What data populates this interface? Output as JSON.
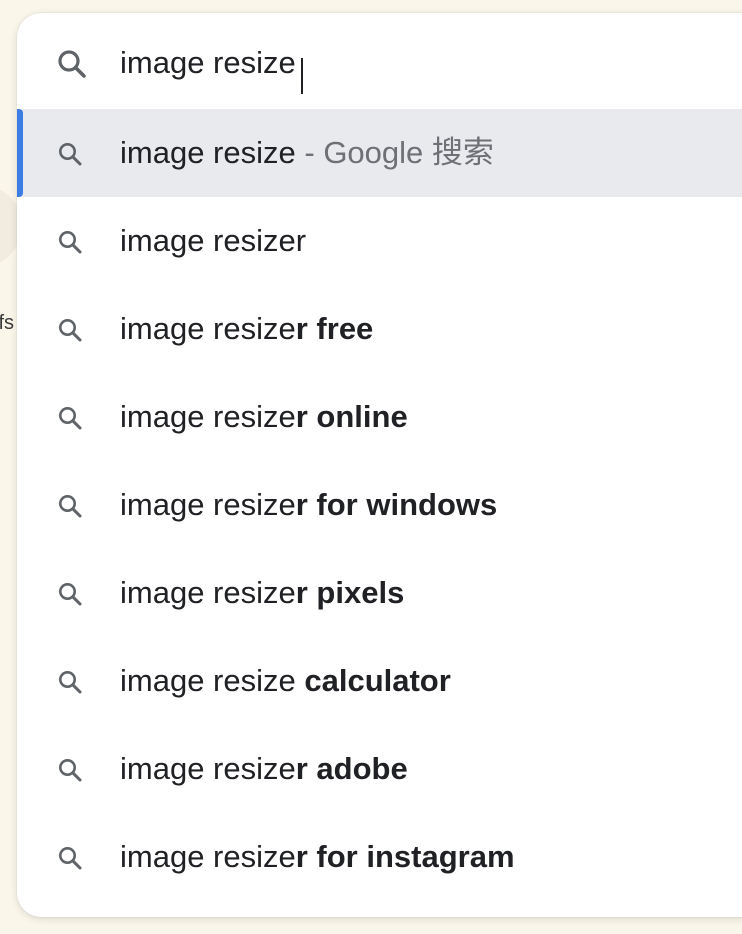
{
  "background": {
    "fragment_text": "fs"
  },
  "omnibox": {
    "input_value": "image resize",
    "icon": "search-icon"
  },
  "suggestions": [
    {
      "prefix": "image resize",
      "suffix": "",
      "separator": " - ",
      "description": "Google 搜索",
      "selected": true,
      "icon": "search-icon"
    },
    {
      "prefix": "image resizer",
      "suffix": "",
      "icon": "search-icon"
    },
    {
      "prefix": "image resize",
      "suffix": "r free",
      "icon": "search-icon"
    },
    {
      "prefix": "image resize",
      "suffix": "r online",
      "icon": "search-icon"
    },
    {
      "prefix": "image resize",
      "suffix": "r for windows",
      "icon": "search-icon"
    },
    {
      "prefix": "image resize",
      "suffix": "r pixels",
      "icon": "search-icon"
    },
    {
      "prefix": "image resize ",
      "suffix": "calculator",
      "icon": "search-icon"
    },
    {
      "prefix": "image resize",
      "suffix": "r adobe",
      "icon": "search-icon"
    },
    {
      "prefix": "image resize",
      "suffix": "r for instagram",
      "icon": "search-icon"
    }
  ],
  "colors": {
    "selected_bg": "#e8eaed",
    "selection_bar": "#3c7ce5",
    "text": "#202124",
    "muted": "#6e7075",
    "page_bg": "#faf6ea"
  }
}
